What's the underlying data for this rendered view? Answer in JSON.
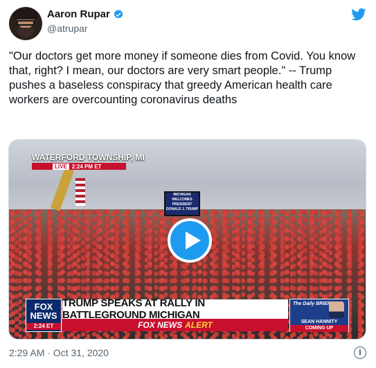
{
  "author": {
    "name": "Aaron Rupar",
    "handle": "@atrupar",
    "verified_color": "#1d9bf0"
  },
  "tweet_text": "\"Our doctors get more money if someone dies from Covid. You know that, right? I mean, our doctors are very smart people.\" -- Trump pushes a baseless conspiracy that greedy American health care workers are overcounting coronavirus deaths",
  "media": {
    "location": "WATERFORD TOWNSHIP, MI",
    "live_label": "LIVE",
    "live_time": "2:24 PM ET",
    "stage_sign": [
      "MICHIGAN",
      "WELCOMES",
      "PRESIDENT",
      "DONALD J. TRUMP"
    ],
    "network": "FOX NEWS",
    "network_time": "2:24 ET",
    "headline": "TRUMP SPEAKS AT RALLY IN BATTLEGROUND MICHIGAN",
    "alert_brand": "FOX NEWS",
    "alert_word": "ALERT",
    "promo_show": "The Daily BRIEFING",
    "promo_host": "SEAN HANNITY",
    "promo_status": "COMING UP"
  },
  "timestamp": "2:29 AM · Oct 31, 2020",
  "icons": {
    "verified": "verified-badge-icon",
    "twitter": "twitter-bird-icon",
    "info": "info-icon",
    "play": "play-icon"
  },
  "colors": {
    "accent": "#1d9bf0",
    "fox_red": "#c8102e",
    "fox_blue": "#0a2a6b"
  }
}
